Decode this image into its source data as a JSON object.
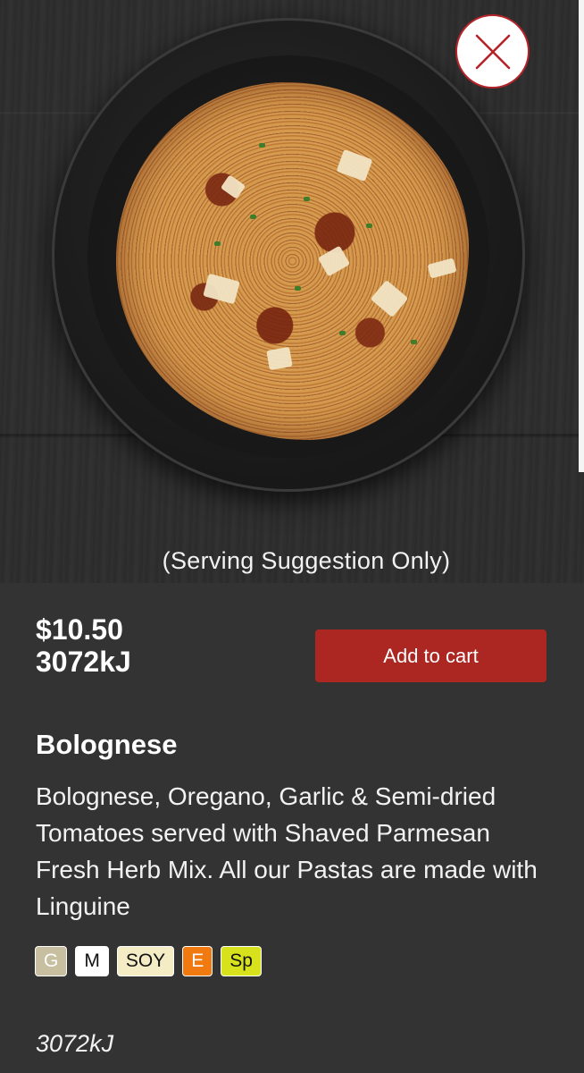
{
  "close_button": {
    "icon": "close-icon",
    "color": "#b5232a"
  },
  "serving_note": "(Serving Suggestion Only)",
  "product": {
    "price": "$10.50",
    "energy": "3072kJ",
    "name": "Bolognese",
    "description": "Bolognese, Oregano, Garlic & Semi-dried Tomatoes served with Shaved Parmesan Fresh Herb Mix. All our Pastas are made with Linguine",
    "energy_footer": "3072kJ"
  },
  "add_to_cart_label": "Add to cart",
  "accent_color": "#ad2722",
  "dietary_tags": [
    {
      "label": "G",
      "bg": "#c8bea0",
      "fg": "#ffffff"
    },
    {
      "label": "M",
      "bg": "#ffffff",
      "fg": "#111111"
    },
    {
      "label": "SOY",
      "bg": "#f4ecc4",
      "fg": "#111111"
    },
    {
      "label": "E",
      "bg": "#f07a10",
      "fg": "#ffffff"
    },
    {
      "label": "Sp",
      "bg": "#d8e21c",
      "fg": "#111111"
    }
  ]
}
